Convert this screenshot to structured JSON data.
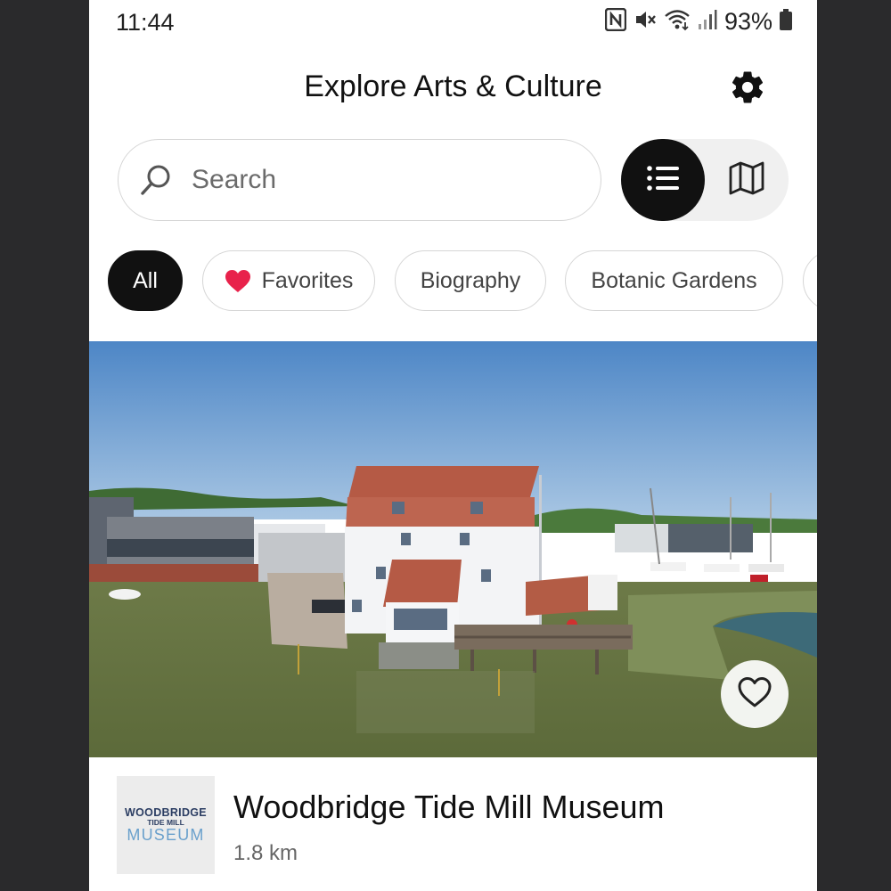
{
  "status_bar": {
    "time": "11:44",
    "battery_percent": "93%",
    "icons": [
      "nfc-icon",
      "mute-icon",
      "wifi-icon",
      "signal-icon",
      "battery-icon"
    ]
  },
  "header": {
    "title": "Explore Arts & Culture",
    "settings_icon": "gear-icon"
  },
  "search": {
    "placeholder": "Search",
    "value": ""
  },
  "view_toggle": {
    "selected": "list",
    "options": [
      "list-icon",
      "map-icon"
    ]
  },
  "filters": {
    "chips": [
      {
        "label": "All",
        "active": true
      },
      {
        "label": "Favorites",
        "icon": "heart-icon",
        "active": false
      },
      {
        "label": "Biography",
        "active": false
      },
      {
        "label": "Botanic Gardens",
        "active": false
      }
    ]
  },
  "card": {
    "title": "Woodbridge Tide Mill Museum",
    "distance": "1.8 km",
    "favorited": false,
    "logo": {
      "line1": "WOODBRIDGE",
      "line2": "TIDE MILL",
      "line3": "MUSEUM"
    }
  },
  "colors": {
    "accent_dark": "#111111",
    "favorite_heart": "#e8224b",
    "chip_border": "#d6d6d6",
    "logo_navy": "#2c3e63",
    "logo_blue": "#6aa0cc"
  }
}
